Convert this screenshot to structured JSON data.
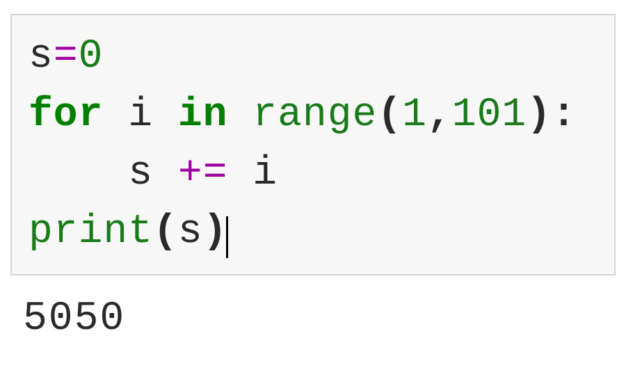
{
  "code": {
    "line1": {
      "var": "s",
      "op": "=",
      "val": "0"
    },
    "line2": {
      "kw_for": "for",
      "var_i": "i",
      "kw_in": "in",
      "builtin": "range",
      "paren_open": "(",
      "arg1": "1",
      "comma": ",",
      "arg2": "101",
      "paren_close": ")",
      "colon": ":"
    },
    "line3": {
      "indent": "    ",
      "var_s": "s",
      "op": "+=",
      "var_i": "i"
    },
    "line4": {
      "builtin": "print",
      "paren_open": "(",
      "arg": "s",
      "paren_close": ")"
    }
  },
  "output": {
    "result": "5050"
  }
}
